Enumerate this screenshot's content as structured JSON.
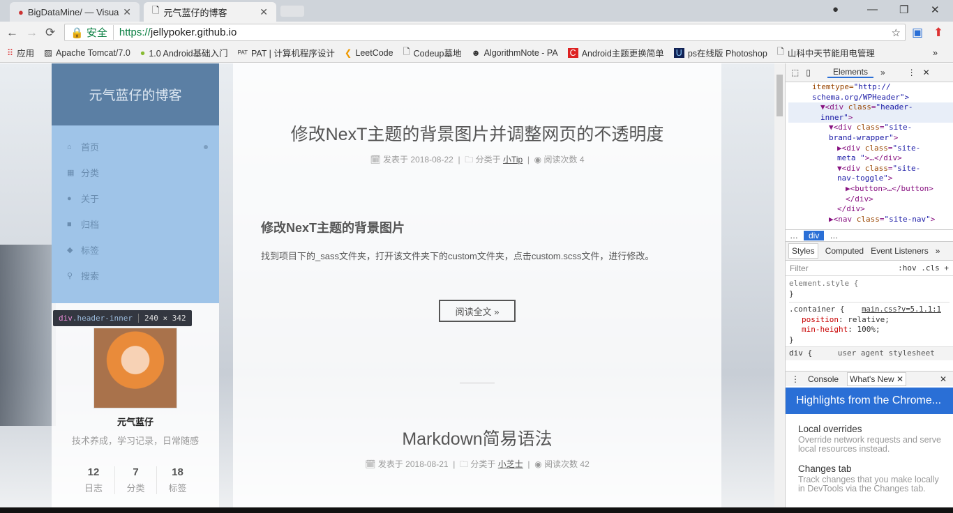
{
  "browser": {
    "tabs": [
      {
        "label": "BigDataMine/ — Visua",
        "active": false
      },
      {
        "label": "元气蓝仔的博客",
        "active": true
      }
    ],
    "secure_label": "安全",
    "url_scheme": "https://",
    "url_host": "jellypoker.github.io",
    "bookmarks": [
      "应用",
      "Apache Tomcat/7.0",
      "1.0 Android基础入门",
      "PAT | 计算机程序设计",
      "LeetCode",
      "Codeup墓地",
      "AlgorithmNote - PA",
      "Android主题更换简单",
      "ps在线版 Photoshop",
      "山科中天节能用电管理"
    ],
    "bookmarks_more": "»"
  },
  "site": {
    "title": "元气蓝仔的博客",
    "menu": [
      {
        "label": "首页",
        "icon": "home-icon"
      },
      {
        "label": "分类",
        "icon": "grid-icon"
      },
      {
        "label": "关于",
        "icon": "user-icon"
      },
      {
        "label": "归档",
        "icon": "archive-icon"
      },
      {
        "label": "标签",
        "icon": "tags-icon"
      },
      {
        "label": "搜索",
        "icon": "search-icon"
      }
    ],
    "inspect_tooltip": {
      "tag": "div",
      "cls": ".header-inner",
      "size": "240 × 342"
    },
    "author": "元气蓝仔",
    "description": "技术养成，学习记录，日常随感",
    "stats": [
      {
        "n": "12",
        "l": "日志"
      },
      {
        "n": "7",
        "l": "分类"
      },
      {
        "n": "18",
        "l": "标签"
      }
    ]
  },
  "posts": [
    {
      "title": "修改NexT主题的背景图片并调整网页的不透明度",
      "posted_label": "发表于",
      "date": "2018-08-22",
      "cat_label": "分类于",
      "category": "小Tip",
      "views_label": "阅读次数",
      "views": "4",
      "h2": "修改NexT主题的背景图片",
      "excerpt": "找到项目下的_sass文件夹，打开该文件夹下的custom文件夹，点击custom.scss文件，进行修改。",
      "read_more": "阅读全文 »"
    },
    {
      "title": "Markdown简易语法",
      "posted_label": "发表于",
      "date": "2018-08-21",
      "cat_label": "分类于",
      "category": "小芝士",
      "views_label": "阅读次数",
      "views": "42"
    }
  ],
  "devtools": {
    "tab": "Elements",
    "crumbs": [
      "…",
      "div",
      "…"
    ],
    "dom": [
      "itemtype=\"http://",
      "schema.org/WPHeader\">",
      "▼<div class=\"header-",
      "inner\">",
      "▼<div class=\"site-",
      "brand-wrapper\">",
      "▶<div class=\"site-",
      "meta \">…</div>",
      "▼<div class=\"site-",
      "nav-toggle\">",
      "▶<button>…</button>",
      "</div>",
      "</div>",
      "▶<nav class=\"site-nav\">"
    ],
    "style_tabs": [
      "Styles",
      "Computed",
      "Event Listeners"
    ],
    "filter": "Filter",
    "hov": ":hov .cls +",
    "css": [
      "element.style {",
      "}",
      ".container {",
      "main.css?v=5.1.1:1",
      "position",
      "relative;",
      "min-height",
      "100%;",
      "}",
      "div {",
      "user agent stylesheet"
    ],
    "drawer_tabs": [
      "Console",
      "What's New"
    ],
    "banner": "Highlights from the Chrome...",
    "news": [
      {
        "h": "Local overrides",
        "p": "Override network requests and serve local resources instead."
      },
      {
        "h": "Changes tab",
        "p": "Track changes that you make locally in DevTools via the Changes tab."
      }
    ]
  }
}
